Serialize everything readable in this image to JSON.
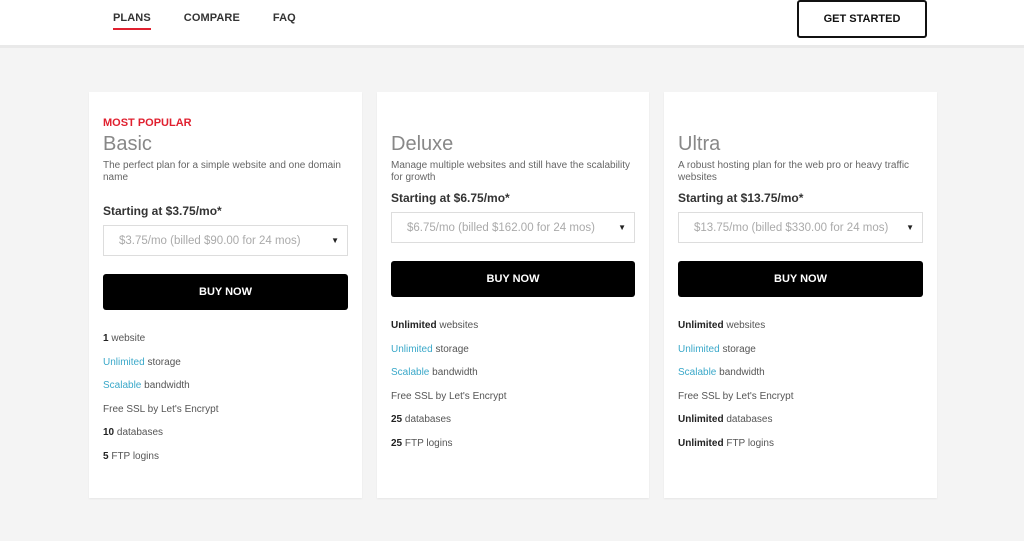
{
  "nav": {
    "items": [
      {
        "label": "PLANS",
        "active": true
      },
      {
        "label": "COMPARE",
        "active": false
      },
      {
        "label": "FAQ",
        "active": false
      }
    ],
    "cta_label": "GET STARTED"
  },
  "colors": {
    "accent_red": "#e0202f",
    "highlight_blue": "#3aa8c9",
    "button_black": "#000000"
  },
  "plans": [
    {
      "badge": "MOST POPULAR",
      "name": "Basic",
      "description": "The perfect plan for a simple website and one domain name",
      "starting": "Starting at $3.75/mo*",
      "billing_option": "$3.75/mo (billed $90.00 for 24 mos)",
      "buy_label": "BUY NOW",
      "features": [
        {
          "strong": "1",
          "rest": " website"
        },
        {
          "highlight": "Unlimited",
          "rest": " storage"
        },
        {
          "highlight": "Scalable",
          "rest": " bandwidth"
        },
        {
          "rest": "Free SSL by Let's Encrypt"
        },
        {
          "strong": "10",
          "rest": " databases"
        },
        {
          "strong": "5",
          "rest": " FTP logins"
        }
      ]
    },
    {
      "badge": "",
      "name": "Deluxe",
      "description": "Manage multiple websites and still have the scalability for growth",
      "starting": "Starting at $6.75/mo*",
      "billing_option": "$6.75/mo (billed $162.00 for 24 mos)",
      "buy_label": "BUY NOW",
      "features": [
        {
          "strong": "Unlimited",
          "rest": " websites"
        },
        {
          "highlight": "Unlimited",
          "rest": " storage"
        },
        {
          "highlight": "Scalable",
          "rest": " bandwidth"
        },
        {
          "rest": "Free SSL by Let's Encrypt"
        },
        {
          "strong": "25",
          "rest": " databases"
        },
        {
          "strong": "25",
          "rest": " FTP logins"
        }
      ]
    },
    {
      "badge": "",
      "name": "Ultra",
      "description": "A robust hosting plan for the web pro or heavy traffic websites",
      "starting": "Starting at $13.75/mo*",
      "billing_option": "$13.75/mo (billed $330.00 for 24 mos)",
      "buy_label": "BUY NOW",
      "features": [
        {
          "strong": "Unlimited",
          "rest": " websites"
        },
        {
          "highlight": "Unlimited",
          "rest": " storage"
        },
        {
          "highlight": "Scalable",
          "rest": " bandwidth"
        },
        {
          "rest": "Free SSL by Let's Encrypt"
        },
        {
          "strong": "Unlimited",
          "rest": " databases"
        },
        {
          "strong": "Unlimited",
          "rest": " FTP logins"
        }
      ]
    }
  ]
}
